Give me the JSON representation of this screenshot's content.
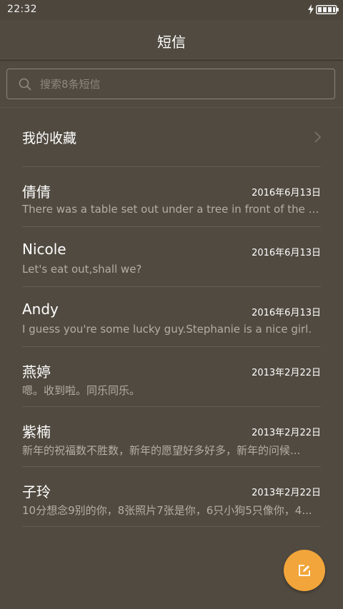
{
  "status_bar": {
    "time": "22:32",
    "icons": [
      "charging-icon",
      "battery-icon"
    ]
  },
  "header": {
    "title": "短信"
  },
  "search": {
    "placeholder": "搜索8条短信",
    "value": "",
    "icon": "search-icon"
  },
  "favorites": {
    "label": "我的收藏",
    "icon": "chevron-right-icon"
  },
  "threads": [
    {
      "name": "倩倩",
      "date": "2016年6月13日",
      "preview": "There was a table set out under a tree in front of the ho..."
    },
    {
      "name": "Nicole",
      "date": "2016年6月13日",
      "preview": "Let's eat out,shall we?"
    },
    {
      "name": "Andy",
      "date": "2016年6月13日",
      "preview": "I guess you're some lucky guy.Stephanie is a nice girl."
    },
    {
      "name": "燕婷",
      "date": "2013年2月22日",
      "preview": "嗯。收到啦。同乐同乐。"
    },
    {
      "name": "紫楠",
      "date": "2013年2月22日",
      "preview": "新年的祝福数不胜数，新年的愿望好多好多，新年的问候..."
    },
    {
      "name": "子玲",
      "date": "2013年2月22日",
      "preview": "10分想念9别的你，8张照片7张是你，6只小狗5只像你，4..."
    }
  ],
  "fab": {
    "icon": "compose-icon"
  },
  "colors": {
    "background": "#514a40",
    "accent": "#f2a53a",
    "preview_text": "#b3aea6",
    "divider": "#645d53"
  }
}
